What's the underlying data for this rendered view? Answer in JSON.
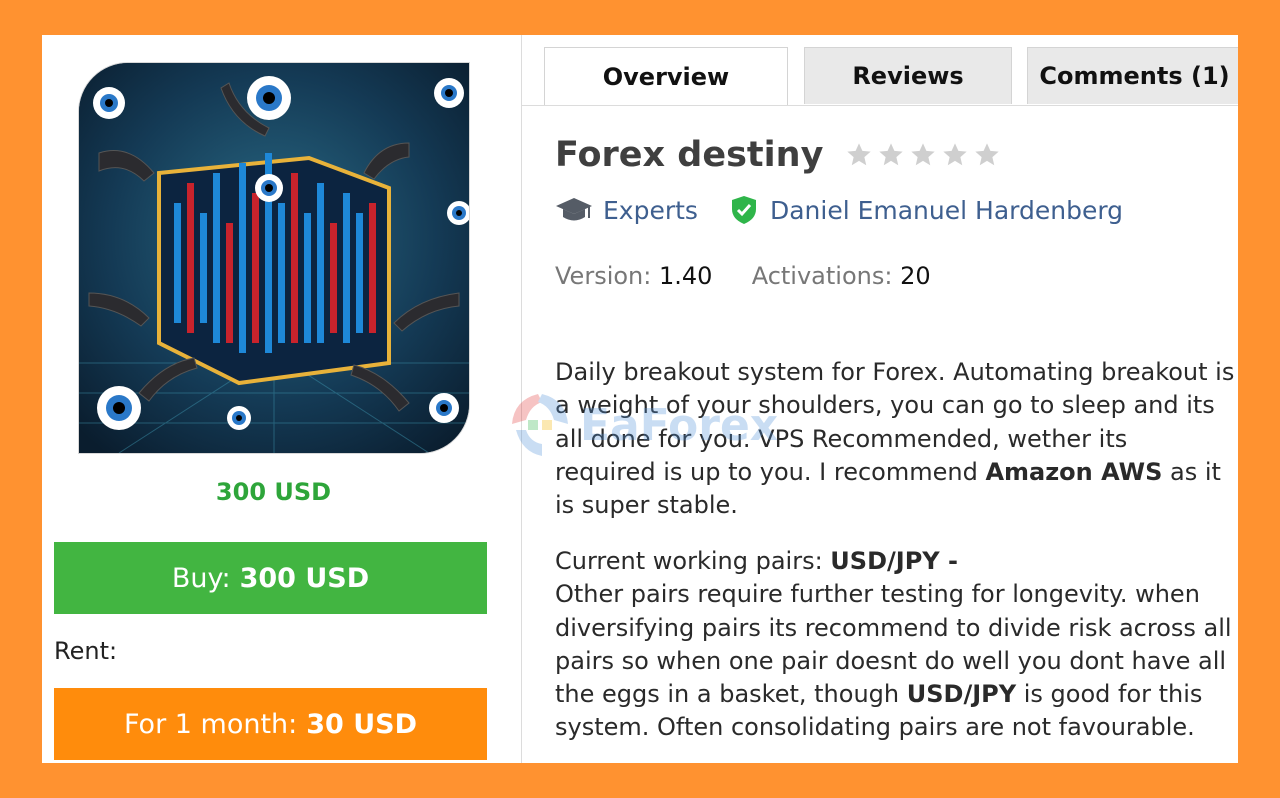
{
  "product": {
    "image_alt": "Forex destiny product artwork",
    "price": "300 USD",
    "buy_label": "Buy:",
    "buy_price": "300 USD",
    "rent_label": "Rent:",
    "rent_period": "For 1 month:",
    "rent_price": "30 USD"
  },
  "tabs": [
    {
      "label": "Overview",
      "active": true
    },
    {
      "label": "Reviews",
      "active": false
    },
    {
      "label": "Comments (1)",
      "active": false
    }
  ],
  "details": {
    "title": "Forex destiny",
    "rating": 0,
    "rating_max": 5,
    "category": "Experts",
    "author": "Daniel Emanuel Hardenberg",
    "version_label": "Version:",
    "version": "1.40",
    "activations_label": "Activations:",
    "activations": "20"
  },
  "description": {
    "p1_text": "Daily breakout system for Forex. Automating breakout is a weight of your shoulders, you can go to sleep and its all done for you. VPS Recommended, wether its required is up to you. I recommend ",
    "p1_bold": "Amazon AWS",
    "p1_end": " as it is super stable.",
    "p2_label": "Current working pairs: ",
    "p2_bold": "USD/JPY -",
    "p3_text": "Other pairs require further testing for longevity. when diversifying pairs its recommend to divide risk across all pairs so when one pair doesnt do well you dont have all the eggs in a basket, though ",
    "p3_bold": "USD/JPY",
    "p3_end": " is good for this system. Often consolidating pairs are not favourable."
  },
  "watermark": "EaForex",
  "colors": {
    "frame": "#ff9230",
    "price_green": "#2ea53a",
    "buy_button": "#42b541",
    "rent_button": "#ff8c0c",
    "link_blue": "#3e5f8f",
    "verified_green": "#2fb54a"
  },
  "icons": {
    "category": "graduation-cap-icon",
    "author": "verified-shield-icon",
    "rating": "star-icon"
  }
}
